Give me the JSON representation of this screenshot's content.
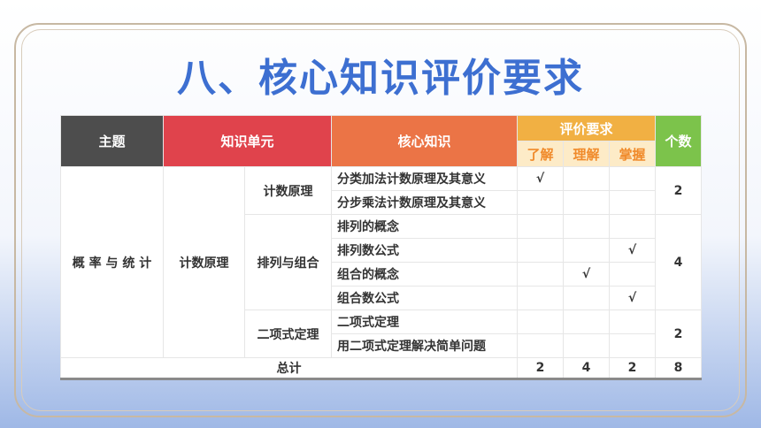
{
  "title": "八、核心知识评价要求",
  "headers": {
    "theme": "主题",
    "unit": "知识单元",
    "core": "核心知识",
    "eval": "评价要求",
    "count": "个数",
    "levels": [
      "了解",
      "理解",
      "掌握"
    ]
  },
  "theme": "概 率 与 统 计",
  "unit": "计数原理",
  "groups": [
    {
      "name": "计数原理",
      "count": "2"
    },
    {
      "name": "排列与组合",
      "count": "4"
    },
    {
      "name": "二项式定理",
      "count": "2"
    }
  ],
  "rows": [
    {
      "knowledge": "分类加法计数原理及其意义",
      "marks": [
        "√",
        "",
        ""
      ]
    },
    {
      "knowledge": "分步乘法计数原理及其意义",
      "marks": [
        "",
        "",
        ""
      ]
    },
    {
      "knowledge": "排列的概念",
      "marks": [
        "",
        "",
        ""
      ]
    },
    {
      "knowledge": "排列数公式",
      "marks": [
        "",
        "",
        "√"
      ]
    },
    {
      "knowledge": "组合的概念",
      "marks": [
        "",
        "√",
        ""
      ]
    },
    {
      "knowledge": "组合数公式",
      "marks": [
        "",
        "",
        "√"
      ]
    },
    {
      "knowledge": "二项式定理",
      "marks": [
        "",
        "",
        ""
      ]
    },
    {
      "knowledge": "用二项式定理解决简单问题",
      "marks": [
        "",
        "",
        ""
      ]
    }
  ],
  "total": {
    "label": "总计",
    "values": [
      "2",
      "4",
      "2",
      "8"
    ]
  },
  "colors": {
    "title": "#3d6fd1",
    "theme_header": "#4d4d4d",
    "unit_header": "#e0434c",
    "core_header": "#eb7446",
    "eval_header": "#f1b043",
    "count_header": "#7cc34b"
  }
}
